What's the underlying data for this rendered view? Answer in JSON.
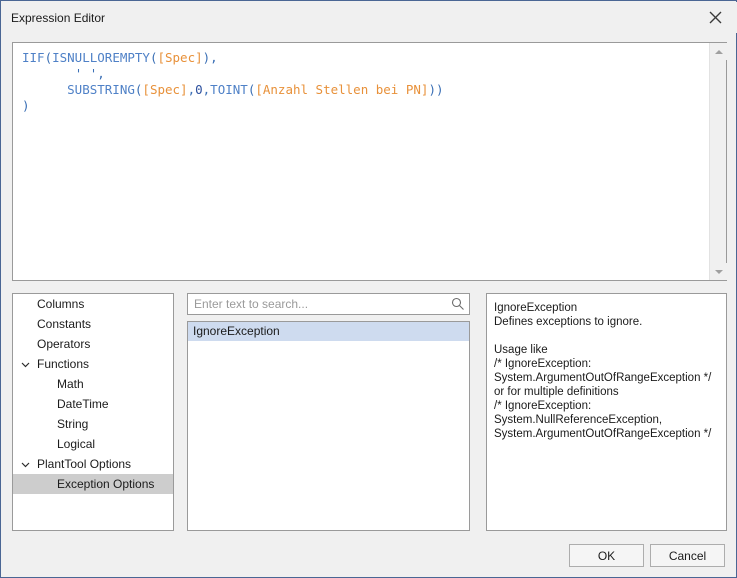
{
  "window": {
    "title": "Expression Editor",
    "close_icon": "close-icon",
    "accent_border": "#4a6694",
    "background": "#f0f0f0"
  },
  "editor": {
    "name": "expression-code-editor",
    "lines": [
      [
        {
          "t": "IIF",
          "c": "tok-fn"
        },
        {
          "t": "(",
          "c": "tok-par"
        },
        {
          "t": "ISNULLOREMPTY",
          "c": "tok-fn"
        },
        {
          "t": "(",
          "c": "tok-par"
        },
        {
          "t": "[Spec]",
          "c": "tok-fld"
        },
        {
          "t": ")",
          "c": "tok-par"
        },
        {
          "t": ",",
          "c": "tok-com"
        }
      ],
      [
        {
          "t": "       ",
          "c": "tok-com"
        },
        {
          "t": "'",
          "c": "tok-q"
        },
        {
          "t": " ",
          "c": "tok-str"
        },
        {
          "t": "'",
          "c": "tok-q"
        },
        {
          "t": ",",
          "c": "tok-com"
        }
      ],
      [
        {
          "t": "      ",
          "c": "tok-com"
        },
        {
          "t": "SUBSTRING",
          "c": "tok-fn"
        },
        {
          "t": "(",
          "c": "tok-par"
        },
        {
          "t": "[Spec]",
          "c": "tok-fld"
        },
        {
          "t": ",",
          "c": "tok-com"
        },
        {
          "t": "0",
          "c": "tok-num"
        },
        {
          "t": ",",
          "c": "tok-com"
        },
        {
          "t": "TOINT",
          "c": "tok-fn"
        },
        {
          "t": "(",
          "c": "tok-par"
        },
        {
          "t": "[Anzahl Stellen bei PN]",
          "c": "tok-fld"
        },
        {
          "t": "))",
          "c": "tok-par"
        }
      ],
      [
        {
          "t": ")",
          "c": "tok-par"
        }
      ]
    ],
    "scrollbar": {
      "up_arrow": "scroll-up-arrow",
      "down_arrow": "scroll-down-arrow"
    }
  },
  "tree": {
    "items": [
      {
        "label": "Columns",
        "level": 1,
        "expander": "",
        "selected": false
      },
      {
        "label": "Constants",
        "level": 1,
        "expander": "",
        "selected": false
      },
      {
        "label": "Operators",
        "level": 1,
        "expander": "",
        "selected": false
      },
      {
        "label": "Functions",
        "level": 1,
        "expander": "chevron-down-icon",
        "selected": false
      },
      {
        "label": "Math",
        "level": 2,
        "expander": "",
        "selected": false
      },
      {
        "label": "DateTime",
        "level": 2,
        "expander": "",
        "selected": false
      },
      {
        "label": "String",
        "level": 2,
        "expander": "",
        "selected": false
      },
      {
        "label": "Logical",
        "level": 2,
        "expander": "",
        "selected": false
      },
      {
        "label": "PlantTool Options",
        "level": 1,
        "expander": "chevron-down-icon",
        "selected": false
      },
      {
        "label": "Exception Options",
        "level": 2,
        "expander": "",
        "selected": true
      }
    ]
  },
  "search": {
    "value": "",
    "placeholder": "Enter text to search...",
    "icon": "search-icon"
  },
  "list": {
    "items": [
      {
        "label": "IgnoreException",
        "selected": true
      }
    ],
    "selection_color": "#cedbef"
  },
  "description": {
    "text": "IgnoreException\nDefines exceptions to ignore.\n\nUsage like\n/* IgnoreException:\nSystem.ArgumentOutOfRangeException */\nor for multiple definitions\n/* IgnoreException:\nSystem.NullReferenceException,\nSystem.ArgumentOutOfRangeException */"
  },
  "footer": {
    "ok_label": "OK",
    "cancel_label": "Cancel"
  }
}
